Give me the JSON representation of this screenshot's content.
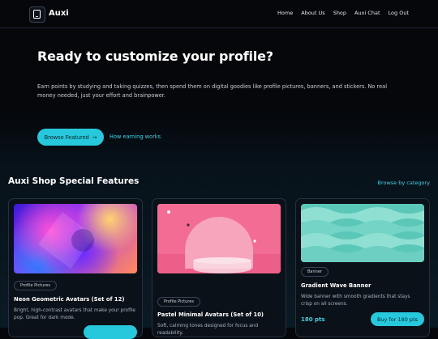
{
  "nav": {
    "brand": "Auxi",
    "links": [
      "Home",
      "About Us",
      "Shop",
      "Auxi Chat",
      "Log Out"
    ]
  },
  "hero": {
    "title": "Ready to customize your profile?",
    "description": "Earn points by studying and taking quizzes, then spend them on digital goodies like profile pictures, banners, and stickers. No real money needed, just your effort and brainpower.",
    "primary_button": "Browse Featured",
    "secondary_link": "How earning works"
  },
  "section": {
    "title": "Auxi Shop Special Features",
    "browse_link": "Browse by category"
  },
  "cards": [
    {
      "tag": "Profile Pictures",
      "title": "Neon Geometric Avatars (Set of 12)",
      "description": "Bright, high-contrast avatars that make your profile pop. Great for dark mode."
    },
    {
      "tag": "Profile Pictures",
      "title": "Pastel Minimal Avatars (Set of 10)",
      "description": "Soft, calming tones designed for focus and readability."
    },
    {
      "tag": "Banner",
      "title": "Gradient Wave Banner",
      "description": "Wide banner with smooth gradients that stays crisp on all screens.",
      "price": "180 pts",
      "buy_label": "Buy for 180 pts"
    }
  ],
  "colors": {
    "accent": "#27c8dc",
    "background": "#05070b"
  }
}
